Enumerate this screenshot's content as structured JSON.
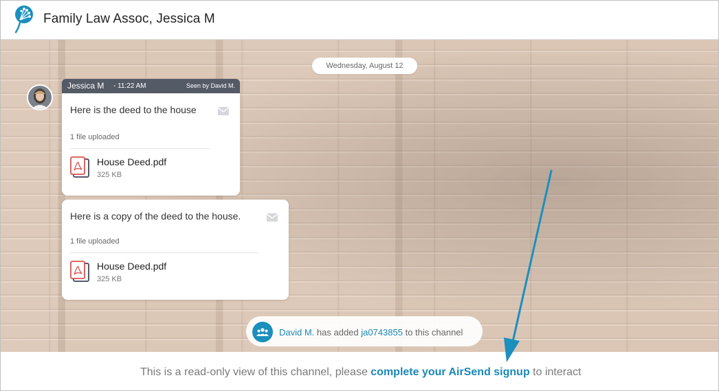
{
  "header": {
    "title": "Family Law Assoc, Jessica M"
  },
  "chat": {
    "date_label": "Wednesday, August 12",
    "messages": [
      {
        "author": "Jessica M",
        "separator": " - ",
        "time": "11:22 AM",
        "seen": "Seen by David M.",
        "text": "Here is the deed to the house",
        "uploaded_label": "1 file uploaded",
        "file_name": "House Deed.pdf",
        "file_size": "325 KB"
      },
      {
        "text": "Here is a copy of the deed to the house.",
        "uploaded_label": "1 file uploaded",
        "file_name": "House Deed.pdf",
        "file_size": "325 KB"
      }
    ],
    "notice": {
      "actor": "David M.",
      "middle": " has added ",
      "target": "ja0743855",
      "end": " to this channel"
    }
  },
  "footer": {
    "prefix": "This is a read-only view of this channel, please ",
    "link": "complete your AirSend signup",
    "suffix": " to interact"
  },
  "colors": {
    "accent": "#1a88b8",
    "header_bar": "#555a67",
    "arrow": "#1b8fbd"
  },
  "icons": [
    "airsend-logo-icon",
    "envelope-icon",
    "pdf-file-icon",
    "group-icon",
    "user-avatar"
  ]
}
